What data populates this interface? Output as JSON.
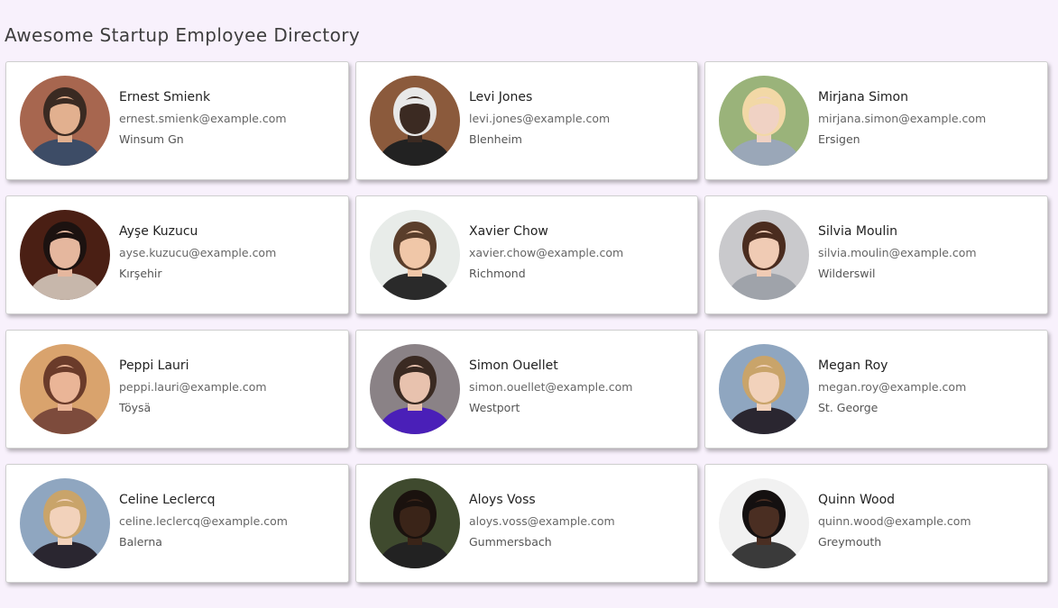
{
  "header": {
    "title": "Awesome Startup Employee Directory"
  },
  "employees": [
    {
      "name": "Ernest Smienk",
      "email": "ernest.smienk@example.com",
      "city": "Winsum Gn",
      "bg": "#a7664f",
      "skin": "#e2b08f",
      "hair": "#3a2a22",
      "shirt": "#3d4c66"
    },
    {
      "name": "Levi Jones",
      "email": "levi.jones@example.com",
      "city": "Blenheim",
      "bg": "#8b5a3c",
      "skin": "#3b2a22",
      "hair": "#e8e8e8",
      "shirt": "#222222"
    },
    {
      "name": "Mirjana Simon",
      "email": "mirjana.simon@example.com",
      "city": "Ersigen",
      "bg": "#9ab37a",
      "skin": "#f0d2c4",
      "hair": "#f2d8a6",
      "shirt": "#9aa7b8"
    },
    {
      "name": "Ayşe Kuzucu",
      "email": "ayse.kuzucu@example.com",
      "city": "Kırşehir",
      "bg": "#4a1f14",
      "skin": "#e5b79e",
      "hair": "#1c1210",
      "shirt": "#c7b7ab"
    },
    {
      "name": "Xavier Chow",
      "email": "xavier.chow@example.com",
      "city": "Richmond",
      "bg": "#e8ece9",
      "skin": "#f0c7a8",
      "hair": "#5a3e2b",
      "shirt": "#2a2a2a"
    },
    {
      "name": "Silvia Moulin",
      "email": "silvia.moulin@example.com",
      "city": "Wilderswil",
      "bg": "#c9c9cc",
      "skin": "#f0cbb4",
      "hair": "#4a2c1f",
      "shirt": "#9fa3aa"
    },
    {
      "name": "Peppi Lauri",
      "email": "peppi.lauri@example.com",
      "city": "Töysä",
      "bg": "#d9a36d",
      "skin": "#eab597",
      "hair": "#6a3b2a",
      "shirt": "#7d4b3c"
    },
    {
      "name": "Simon Ouellet",
      "email": "simon.ouellet@example.com",
      "city": "Westport",
      "bg": "#8a8286",
      "skin": "#e8c2ae",
      "hair": "#3a2a22",
      "shirt": "#4a1fb8"
    },
    {
      "name": "Megan Roy",
      "email": "megan.roy@example.com",
      "city": "St. George",
      "bg": "#8fa6c0",
      "skin": "#f2d2bb",
      "hair": "#c9a46a",
      "shirt": "#2a2630"
    },
    {
      "name": "Celine Leclercq",
      "email": "celine.leclercq@example.com",
      "city": "Balerna",
      "bg": "#8fa6c0",
      "skin": "#f2d2bb",
      "hair": "#c9a46a",
      "shirt": "#2a2630"
    },
    {
      "name": "Aloys Voss",
      "email": "aloys.voss@example.com",
      "city": "Gummersbach",
      "bg": "#3f4a2e",
      "skin": "#3a2418",
      "hair": "#1a120e",
      "shirt": "#222222"
    },
    {
      "name": "Quinn Wood",
      "email": "quinn.wood@example.com",
      "city": "Greymouth",
      "bg": "#f1f1f1",
      "skin": "#4a2e22",
      "hair": "#141010",
      "shirt": "#3a3a3a"
    }
  ]
}
